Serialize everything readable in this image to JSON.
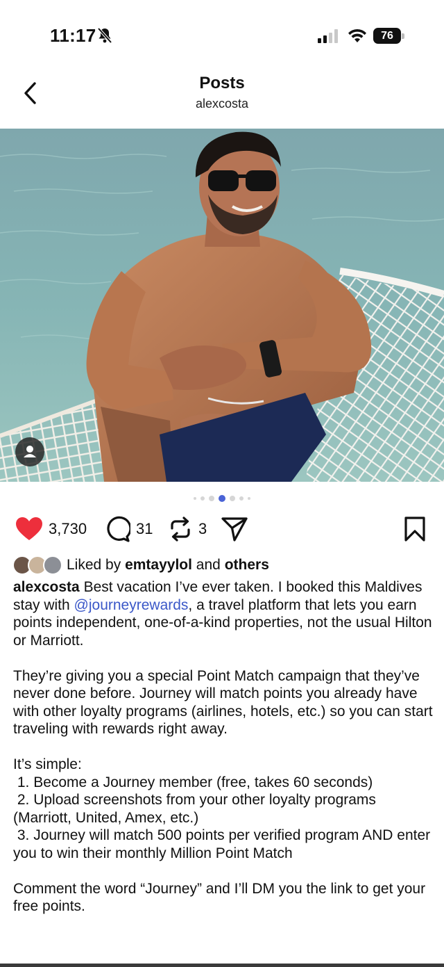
{
  "status_bar": {
    "time": "11:17",
    "battery": "76",
    "icons": [
      "bell-off-icon",
      "signal-icon",
      "wifi-icon",
      "battery-icon"
    ]
  },
  "header": {
    "title": "Posts",
    "subtitle": "alexcosta",
    "back_icon": "chevron-left-icon"
  },
  "post": {
    "image_description_icon": "user-tag-icon",
    "carousel": {
      "total_dots": 7,
      "active_index": 3,
      "accent": "#4a63d6"
    },
    "actions": {
      "likes": "3,730",
      "comments": "31",
      "reposts": "3",
      "like_color": "#ed2f3c"
    },
    "liked_by": {
      "prefix": "Liked by",
      "user": "emtayylol",
      "and": "and",
      "others": "others"
    },
    "caption": {
      "username": "alexcosta",
      "text_1": " Best vacation I’ve ever taken. I booked this Maldives stay with ",
      "mention": "@journeyrewards",
      "text_2": ", a travel platform that lets you earn points independent, one-of-a-kind properties, not the usual Hilton or Marriott.\n\nThey’re giving you a special Point Match campaign that they’ve never done before. Journey will match points you already have with other loyalty programs (airlines, hotels, etc.) so you can start traveling with rewards right away.\n\nIt’s simple:\n 1. Become a Journey member (free, takes 60 seconds)\n 2. Upload screenshots from your other loyalty programs (Marriott, United, Amex, etc.)\n 3. Journey will match 500 points per verified program AND enter you to win their monthly Million Point Match\n\nComment the word “Journey” and I’ll DM you the link to get your free points."
    }
  }
}
